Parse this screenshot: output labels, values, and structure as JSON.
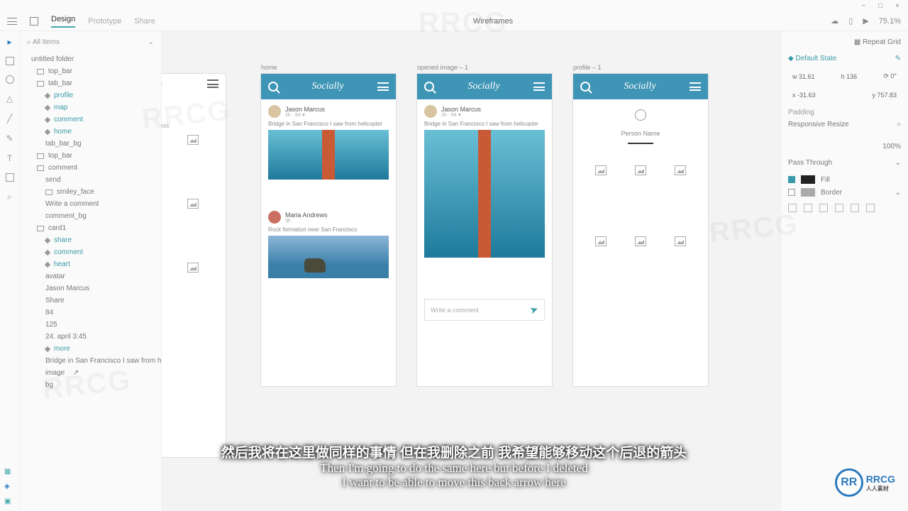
{
  "window": {
    "zoom": "75.1%",
    "min": "−",
    "max": "□",
    "close": "×"
  },
  "topbar": {
    "tabs": {
      "design": "Design",
      "prototype": "Prototype",
      "share": "Share"
    },
    "doc_title": "Wireframes"
  },
  "layers": {
    "search": "All Items",
    "artboard_group": "untitled folder",
    "items": [
      "top_bar",
      "tab_bar",
      "profile",
      "map",
      "comment",
      "home",
      "tab_bar_bg",
      "top_bar",
      "comment",
      "send",
      "smiley_face",
      "Write a comment",
      "comment_bg",
      "card1",
      "share",
      "comment",
      "heart",
      "avatar",
      "Jason Marcus",
      "Share",
      "84",
      "125",
      "24. april 3:45",
      "more",
      "Bridge in San Francisco I saw from helico...",
      "image",
      "bg"
    ]
  },
  "artboards": {
    "ab1_label": "logo",
    "ab2_label": "home",
    "ab3_label": "opened image – 1",
    "ab4_label": "profile – 1"
  },
  "app": {
    "title": "Socially",
    "post1_name": "Jason Marcus",
    "post1_sub": "2h · 84 ♥",
    "post1_caption": "Bridge in San Francisco I saw from helicopter",
    "post2_name": "Maria Andrews",
    "post2_sub": "3h",
    "post2_caption": "Rock formation near San Francisco",
    "comment_placeholder": "Write a comment",
    "profile_name": "Person Name"
  },
  "panel": {
    "repeat_grid": "Repeat Grid",
    "default_state": "Default State",
    "w": "31.61",
    "h": "136",
    "rot": "0°",
    "x": "-31.63",
    "y": "757.83",
    "padding": "Padding",
    "responsive": "Responsive Resize",
    "opacity": "100%",
    "blend": "Pass Through",
    "fill": "Fill",
    "border": "Border"
  },
  "subtitle": {
    "cn": "然后我将在这里做同样的事情 但在我删除之前 我希望能够移动这个后退的箭头",
    "en1": "Then I'm going to do the same here but before I deleted",
    "en2": "I want to be able to move this back arrow here"
  },
  "brand": {
    "logo": "RR",
    "name": "RRCG",
    "sub": "人人素材"
  },
  "watermark": "RRCG"
}
